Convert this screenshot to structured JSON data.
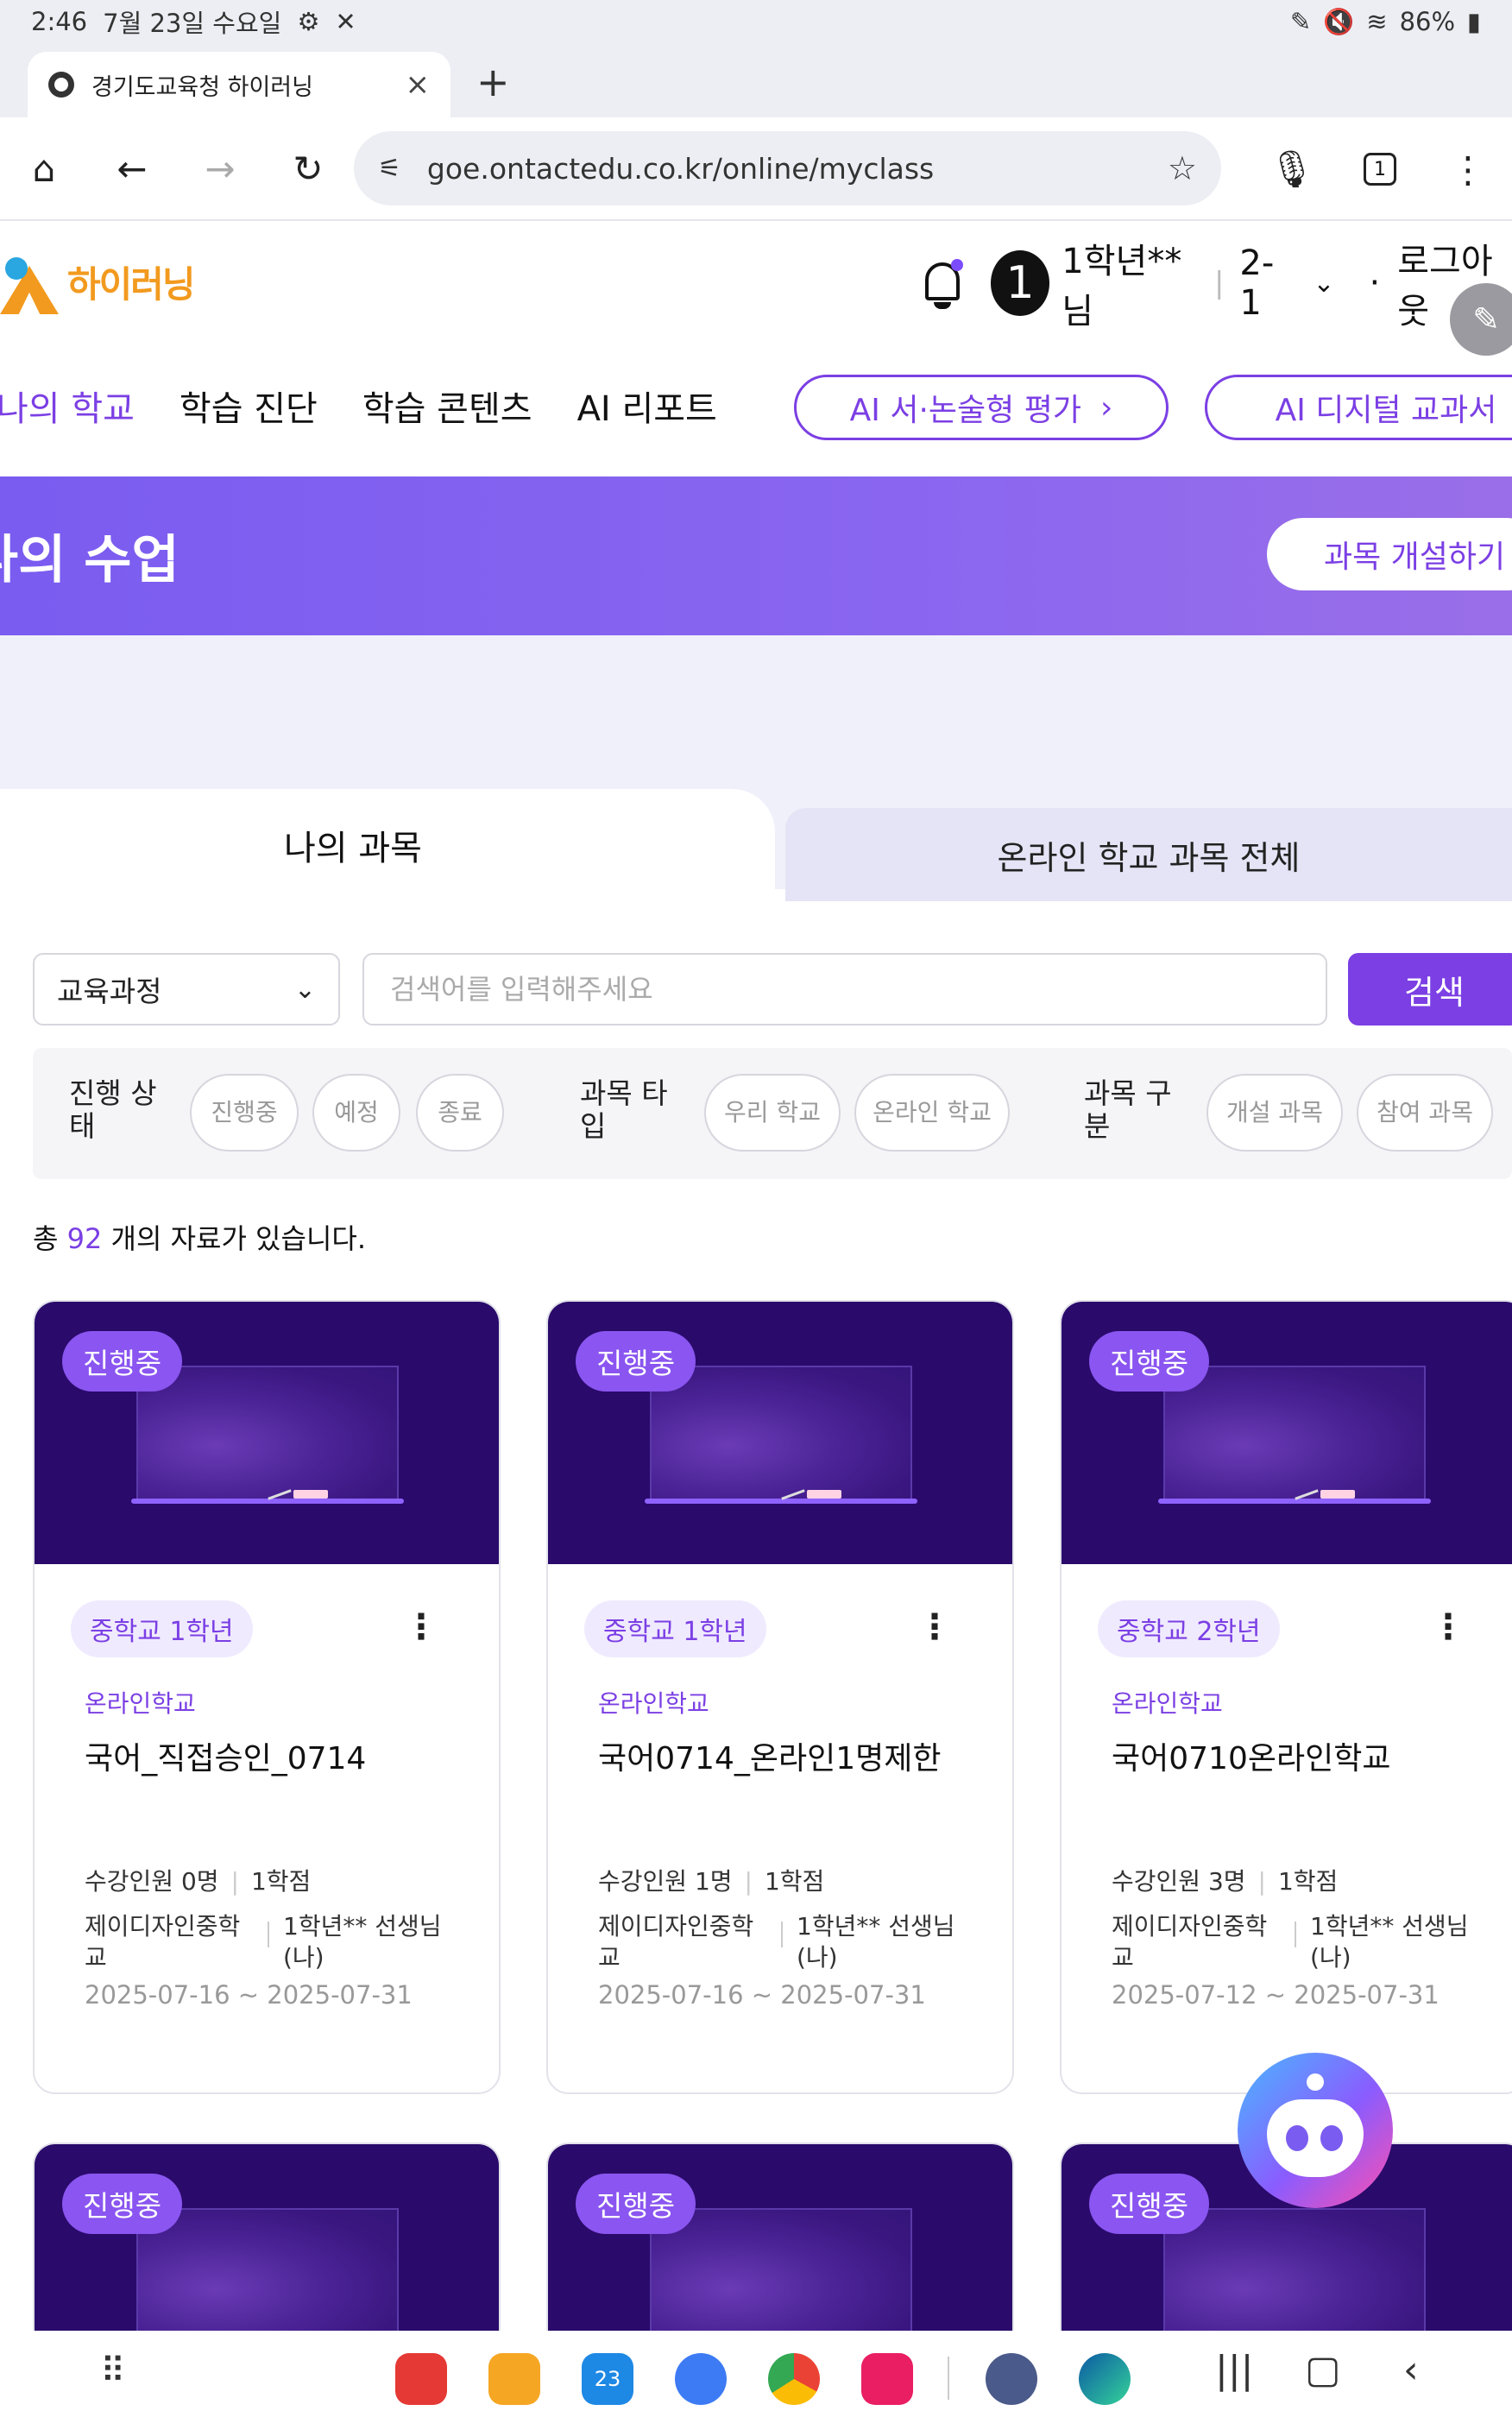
{
  "status_bar": {
    "time": "2:46",
    "date": "7월 23일 수요일",
    "battery": "86%"
  },
  "browser": {
    "tab_title": "경기도교육청 하이러닝",
    "url": "goe.ontactedu.co.kr/online/myclass",
    "tab_count": "1"
  },
  "header": {
    "logo_text": "하이러닝",
    "notification_count": "1",
    "user_name": "1학년**님",
    "class": "2-1",
    "logout": "로그아웃"
  },
  "nav": {
    "items": [
      "나의 학교",
      "학습 진단",
      "학습 콘텐츠",
      "AI 리포트"
    ],
    "btn_ai_essay": "AI 서·논술형 평가",
    "btn_ai_textbook": "AI 디지털 교과서"
  },
  "banner": {
    "title": "나의 수업",
    "create_course": "과목 개설하기"
  },
  "tabs": {
    "mine": "나의 과목",
    "all": "온라인 학교 과목 전체"
  },
  "search": {
    "select_value": "교육과정",
    "placeholder": "검색어를 입력해주세요",
    "button": "검색"
  },
  "filters": {
    "status_label": "진행 상태",
    "status_options": [
      "진행중",
      "예정",
      "종료"
    ],
    "type_label": "과목 타입",
    "type_options": [
      "우리 학교",
      "온라인 학교"
    ],
    "category_label": "과목 구분",
    "category_options": [
      "개설 과목",
      "참여 과목"
    ]
  },
  "total": {
    "prefix": "총",
    "count": "92",
    "suffix": "개의 자료가 있습니다."
  },
  "courses": [
    {
      "badge": "진행중",
      "grade": "중학교 1학년",
      "school_type": "온라인학교",
      "title": "국어_직접승인_0714",
      "students": "수강인원 0명",
      "credits": "1학점",
      "school": "제이디자인중학교",
      "teacher": "1학년** 선생님(나)",
      "dates": "2025-07-16 ~ 2025-07-31"
    },
    {
      "badge": "진행중",
      "grade": "중학교 1학년",
      "school_type": "온라인학교",
      "title": "국어0714_온라인1명제한",
      "students": "수강인원 1명",
      "credits": "1학점",
      "school": "제이디자인중학교",
      "teacher": "1학년** 선생님(나)",
      "dates": "2025-07-16 ~ 2025-07-31"
    },
    {
      "badge": "진행중",
      "grade": "중학교 2학년",
      "school_type": "온라인학교",
      "title": "국어0710온라인학교",
      "students": "수강인원 3명",
      "credits": "1학점",
      "school": "제이디자인중학교",
      "teacher": "1학년** 선생님(나)",
      "dates": "2025-07-12 ~ 2025-07-31"
    }
  ],
  "courses_row2": [
    {
      "badge": "진행중"
    },
    {
      "badge": "진행중"
    },
    {
      "badge": "진행중"
    }
  ],
  "bottom_nav": {
    "calendar_day": "23"
  },
  "colors": {
    "accent": "#7b3fe4",
    "banner": "#8a66f0",
    "thumb_bg": "#2a0a6b"
  }
}
